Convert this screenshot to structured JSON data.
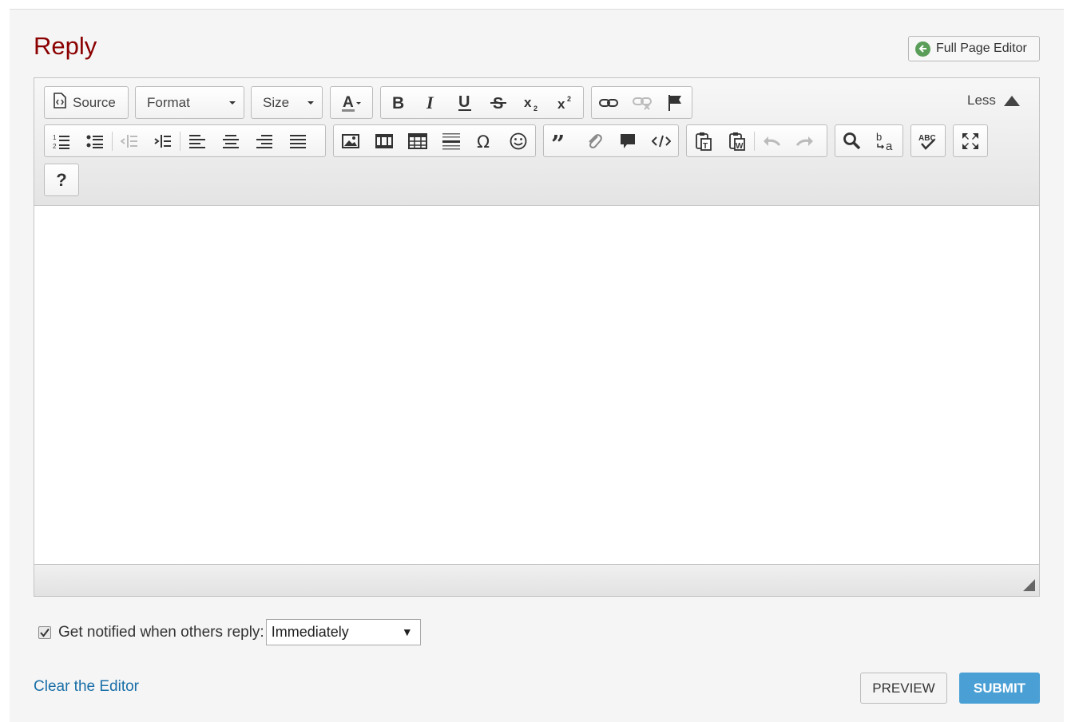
{
  "reply": {
    "title": "Reply"
  },
  "full_page_editor": {
    "label": "Full Page Editor",
    "icon": "back-arrow-icon",
    "icon_color": "#5a9e5a"
  },
  "toolbar": {
    "source_label": "Source",
    "format_label": "Format",
    "size_label": "Size",
    "less_label": "Less",
    "help_label": "?",
    "buttons": [
      "text-color-icon",
      "bold-icon",
      "italic-icon",
      "underline-icon",
      "strikethrough-icon",
      "subscript-icon",
      "superscript-icon",
      "link-icon",
      "unlink-icon",
      "anchor-flag-icon",
      "numbered-list-icon",
      "bulleted-list-icon",
      "decrease-indent-icon",
      "increase-indent-icon",
      "align-left-icon",
      "align-center-icon",
      "align-right-icon",
      "justify-icon",
      "image-icon",
      "media-embed-icon",
      "table-icon",
      "horizontal-line-icon",
      "special-char-icon",
      "smiley-icon",
      "blockquote-icon",
      "attachment-icon",
      "comment-icon",
      "code-snippet-icon",
      "paste-text-icon",
      "paste-word-icon",
      "undo-icon",
      "redo-icon",
      "find-icon",
      "replace-icon",
      "spellcheck-icon",
      "maximize-icon",
      "help-icon"
    ]
  },
  "notify": {
    "label": "Get notified when others reply:",
    "checked": true,
    "selected": "Immediately"
  },
  "actions": {
    "clear_label": "Clear the Editor",
    "preview_label": "PREVIEW",
    "submit_label": "SUBMIT"
  },
  "colors": {
    "title": "#8b0000",
    "link": "#1a6fa8",
    "submit_bg": "#4aa0d5"
  }
}
